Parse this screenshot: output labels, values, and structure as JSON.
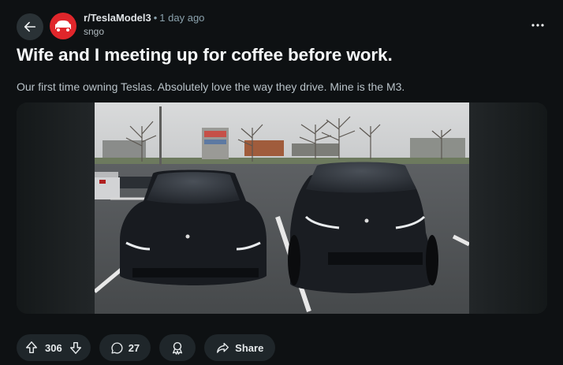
{
  "header": {
    "subreddit": "r/TeslaModel3",
    "separator": "•",
    "time": "1 day ago",
    "author": "sngo"
  },
  "post": {
    "title": "Wife and I meeting up for coffee before work.",
    "body": "Our first time owning Teslas. Absolutely love the way they drive. Mine is the M3."
  },
  "actions": {
    "score": "306",
    "comments": "27",
    "share_label": "Share"
  },
  "icons": {
    "back": "arrow-left-icon",
    "more": "ellipsis-icon",
    "upvote": "arrow-up-icon",
    "downvote": "arrow-down-icon",
    "comment": "speech-bubble-icon",
    "award": "award-icon",
    "share": "share-arrow-icon"
  },
  "colors": {
    "background": "#0e1113",
    "pill": "#1f262a",
    "subreddit_avatar": "#e0262b"
  }
}
